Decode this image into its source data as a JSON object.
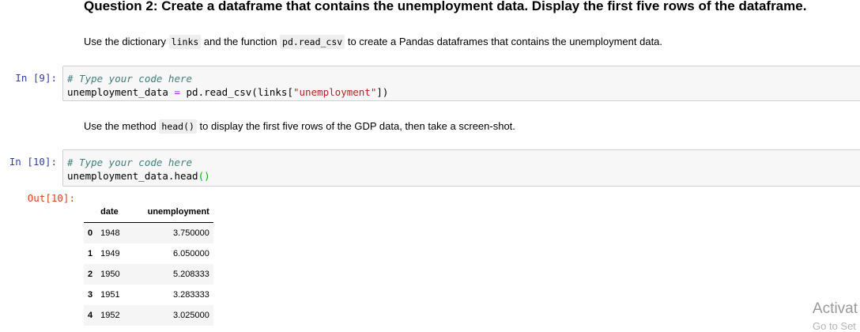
{
  "heading": "Question 2: Create a dataframe that contains the unemployment data. Display the first five rows of the dataframe.",
  "md1": {
    "pre": "Use the dictionary ",
    "code1": "links",
    "mid": " and the function ",
    "code2": "pd.read_csv",
    "post": " to create a Pandas dataframes that contains the unemployment data."
  },
  "cell1": {
    "prompt": "In [9]:",
    "comment": "# Type your code here",
    "line2": {
      "var": "unemployment_data ",
      "op": "=",
      "call": " pd.read_csv(links[",
      "str": "\"unemployment\"",
      "end": "])"
    }
  },
  "md2": {
    "pre": "Use the method ",
    "code": "head()",
    "post": " to display the first five rows of the GDP data, then take a screen-shot."
  },
  "cell2": {
    "prompt": "In [10]:",
    "comment": "# Type your code here",
    "line2": {
      "text": "unemployment_data.head",
      "parens": "()"
    }
  },
  "output": {
    "prompt": "Out[10]:",
    "columns": [
      "",
      "date",
      "unemployment"
    ],
    "rows": [
      {
        "index": "0",
        "date": "1948",
        "unemployment": "3.750000"
      },
      {
        "index": "1",
        "date": "1949",
        "unemployment": "6.050000"
      },
      {
        "index": "2",
        "date": "1950",
        "unemployment": "5.208333"
      },
      {
        "index": "3",
        "date": "1951",
        "unemployment": "3.283333"
      },
      {
        "index": "4",
        "date": "1952",
        "unemployment": "3.025000"
      }
    ]
  },
  "watermark": {
    "title": "Activat",
    "sub": "Go to Set"
  },
  "colors": {
    "prompt_in": "#303f9f",
    "prompt_out": "#d84315",
    "comment": "#408080",
    "string": "#ba2121",
    "operator": "#aa22ff"
  }
}
